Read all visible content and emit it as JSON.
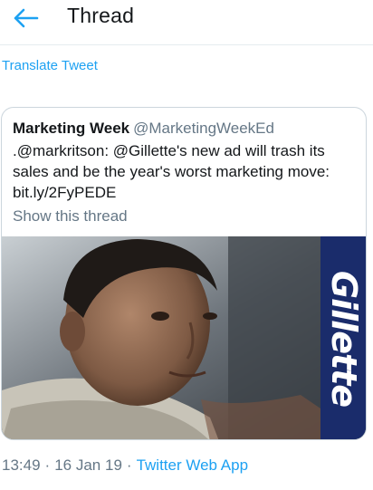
{
  "header": {
    "title": "Thread",
    "back_icon": "arrow-left-icon"
  },
  "tweet": {
    "translate_label": "Translate Tweet"
  },
  "quote": {
    "name": "Marketing Week",
    "handle": "@MarketingWeekEd",
    "text": ".@markritson: @Gillette's new ad will trash its sales and be the year's worst marketing move: bit.ly/2FyPEDE",
    "show_thread": "Show this thread",
    "media": {
      "brand": "Gillette"
    }
  },
  "meta": {
    "time": "13:49",
    "date": "16 Jan 19",
    "separator": "·",
    "app": "Twitter Web App"
  },
  "colors": {
    "link": "#1da1f2",
    "muted": "#657786",
    "text": "#14171a",
    "brand_panel": "#1a2c6b"
  }
}
